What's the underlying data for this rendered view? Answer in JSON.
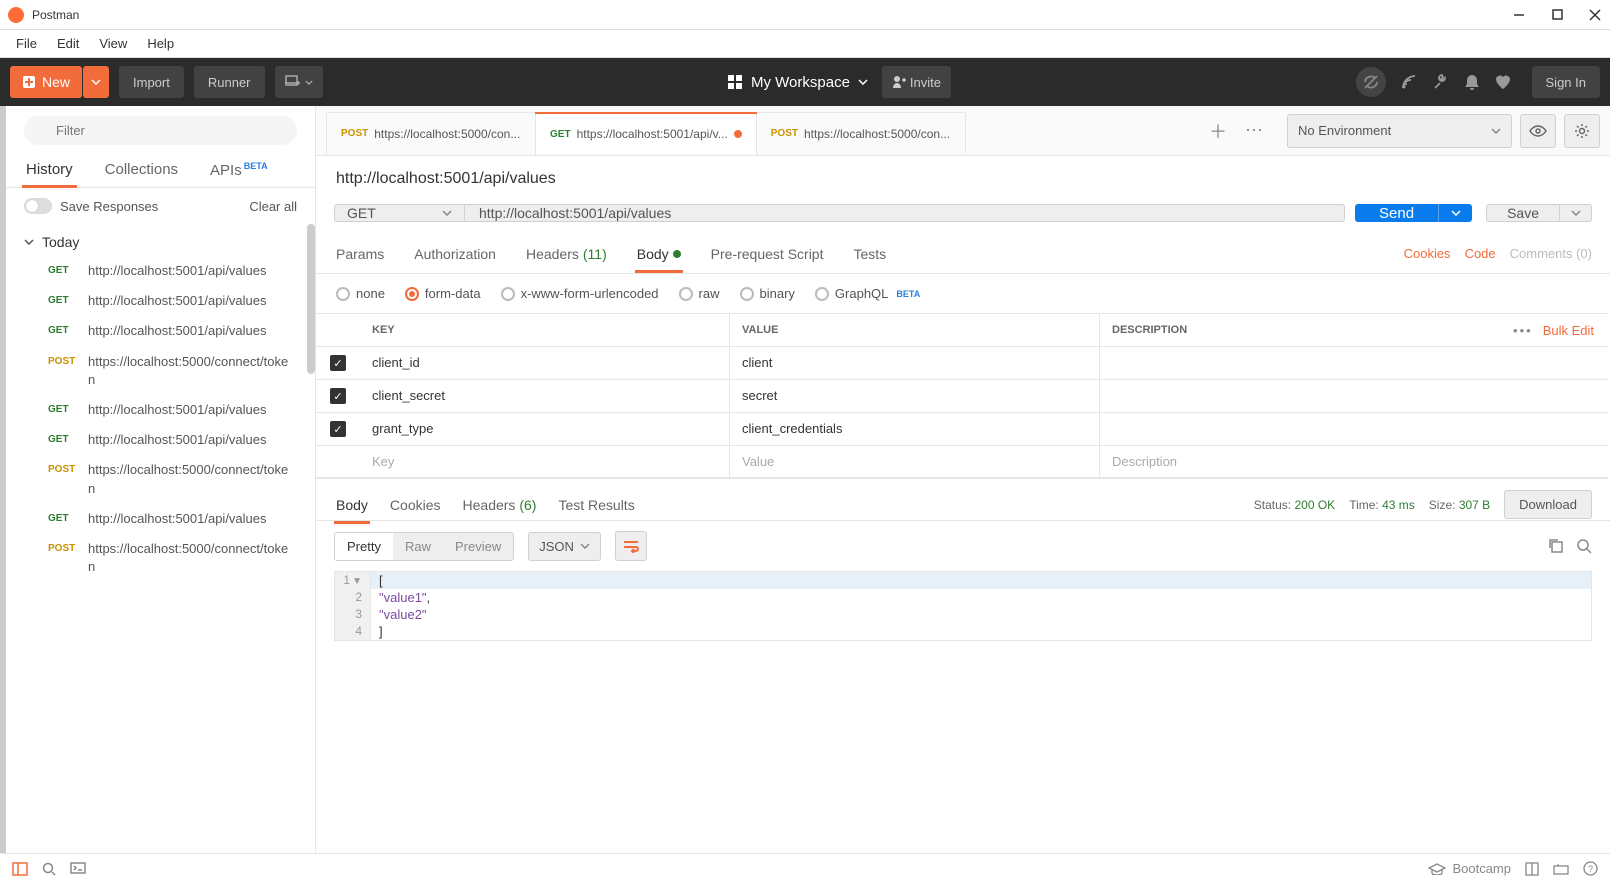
{
  "app": {
    "title": "Postman"
  },
  "menu": [
    "File",
    "Edit",
    "View",
    "Help"
  ],
  "toolbar": {
    "new_label": "New",
    "import_label": "Import",
    "runner_label": "Runner",
    "workspace_label": "My Workspace",
    "invite_label": "Invite",
    "signin_label": "Sign In"
  },
  "sidebar": {
    "filter_placeholder": "Filter",
    "tabs": {
      "history": "History",
      "collections": "Collections",
      "apis": "APIs",
      "beta": "BETA"
    },
    "save_responses_label": "Save Responses",
    "clear_all_label": "Clear all",
    "group_label": "Today",
    "items": [
      {
        "method": "GET",
        "url": "http://localhost:5001/api/values"
      },
      {
        "method": "GET",
        "url": "http://localhost:5001/api/values"
      },
      {
        "method": "GET",
        "url": "http://localhost:5001/api/values"
      },
      {
        "method": "POST",
        "url": "https://localhost:5000/connect/token"
      },
      {
        "method": "GET",
        "url": "http://localhost:5001/api/values"
      },
      {
        "method": "GET",
        "url": "http://localhost:5001/api/values"
      },
      {
        "method": "POST",
        "url": "https://localhost:5000/connect/token"
      },
      {
        "method": "GET",
        "url": "http://localhost:5001/api/values"
      },
      {
        "method": "POST",
        "url": "https://localhost:5000/connect/token"
      }
    ]
  },
  "tabs": [
    {
      "method": "POST",
      "title": "https://localhost:5000/con...",
      "active": false,
      "dirty": false
    },
    {
      "method": "GET",
      "title": "https://localhost:5001/api/v...",
      "active": true,
      "dirty": true
    },
    {
      "method": "POST",
      "title": "https://localhost:5000/con...",
      "active": false,
      "dirty": false
    }
  ],
  "environment": {
    "label": "No Environment"
  },
  "request": {
    "title": "http://localhost:5001/api/values",
    "method": "GET",
    "url": "http://localhost:5001/api/values",
    "send_label": "Send",
    "save_label": "Save",
    "tabs": {
      "params": "Params",
      "authorization": "Authorization",
      "headers": "Headers",
      "headers_count": "(11)",
      "body": "Body",
      "prerequest": "Pre-request Script",
      "tests": "Tests"
    },
    "right_links": {
      "cookies": "Cookies",
      "code": "Code",
      "comments": "Comments (0)"
    },
    "body_types": {
      "none": "none",
      "formdata": "form-data",
      "urlencoded": "x-www-form-urlencoded",
      "raw": "raw",
      "binary": "binary",
      "graphql": "GraphQL",
      "beta": "BETA"
    },
    "table": {
      "headers": {
        "key": "KEY",
        "value": "VALUE",
        "description": "DESCRIPTION"
      },
      "bulk_edit": "Bulk Edit",
      "placeholders": {
        "key": "Key",
        "value": "Value",
        "description": "Description"
      },
      "rows": [
        {
          "key": "client_id",
          "value": "client",
          "desc": ""
        },
        {
          "key": "client_secret",
          "value": "secret",
          "desc": ""
        },
        {
          "key": "grant_type",
          "value": "client_credentials",
          "desc": ""
        }
      ]
    }
  },
  "response": {
    "tabs": {
      "body": "Body",
      "cookies": "Cookies",
      "headers": "Headers",
      "headers_count": "(6)",
      "testresults": "Test Results"
    },
    "status": {
      "label": "Status:",
      "value": "200 OK",
      "time_label": "Time:",
      "time_value": "43 ms",
      "size_label": "Size:",
      "size_value": "307 B"
    },
    "download_label": "Download",
    "views": {
      "pretty": "Pretty",
      "raw": "Raw",
      "preview": "Preview",
      "json": "JSON"
    },
    "body_lines": [
      {
        "n": "1",
        "text": "[",
        "hl": true,
        "fold": true
      },
      {
        "n": "2",
        "text": "    \"value1\","
      },
      {
        "n": "3",
        "text": "    \"value2\""
      },
      {
        "n": "4",
        "text": "]"
      }
    ]
  },
  "statusbar": {
    "bootcamp": "Bootcamp"
  }
}
